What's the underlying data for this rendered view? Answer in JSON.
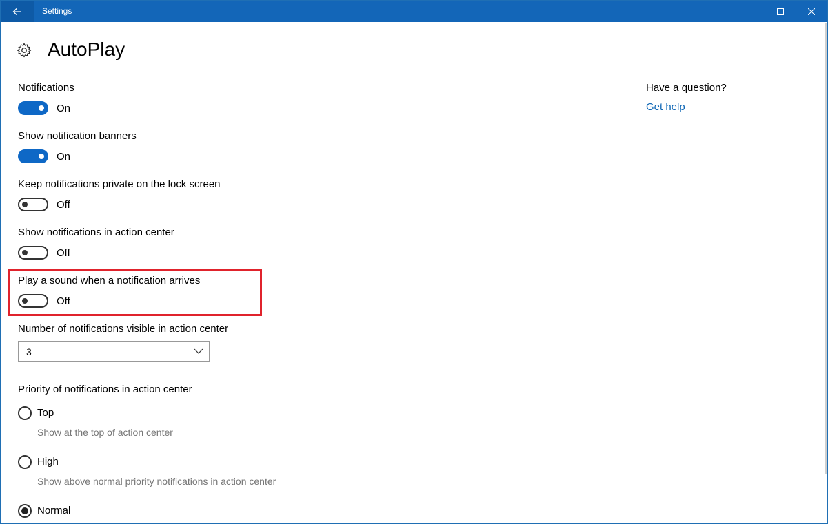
{
  "window": {
    "title": "Settings"
  },
  "page": {
    "title": "AutoPlay"
  },
  "settings": [
    {
      "label": "Notifications",
      "state": "On"
    },
    {
      "label": "Show notification banners",
      "state": "On"
    },
    {
      "label": "Keep notifications private on the lock screen",
      "state": "Off"
    },
    {
      "label": "Show notifications in action center",
      "state": "Off"
    },
    {
      "label": "Play a sound when a notification arrives",
      "state": "Off"
    }
  ],
  "visible_count": {
    "label": "Number of notifications visible in action center",
    "value": "3"
  },
  "priority": {
    "label": "Priority of notifications in action center",
    "options": [
      {
        "label": "Top",
        "description": "Show at the top of action center",
        "selected": false
      },
      {
        "label": "High",
        "description": "Show above normal priority notifications in action center",
        "selected": false
      },
      {
        "label": "Normal",
        "description": "",
        "selected": true
      }
    ]
  },
  "sidebar": {
    "question": "Have a question?",
    "help_link": "Get help"
  },
  "colors": {
    "titlebar": "#1366b8",
    "accent": "#0e68c6",
    "highlight": "#e0232c",
    "link": "#0a64b4"
  },
  "icons": {
    "back": "arrow-left-icon",
    "header": "gear-icon",
    "minimize": "minimize-icon",
    "maximize": "maximize-icon",
    "close": "close-icon",
    "dropdown": "chevron-down-icon"
  }
}
